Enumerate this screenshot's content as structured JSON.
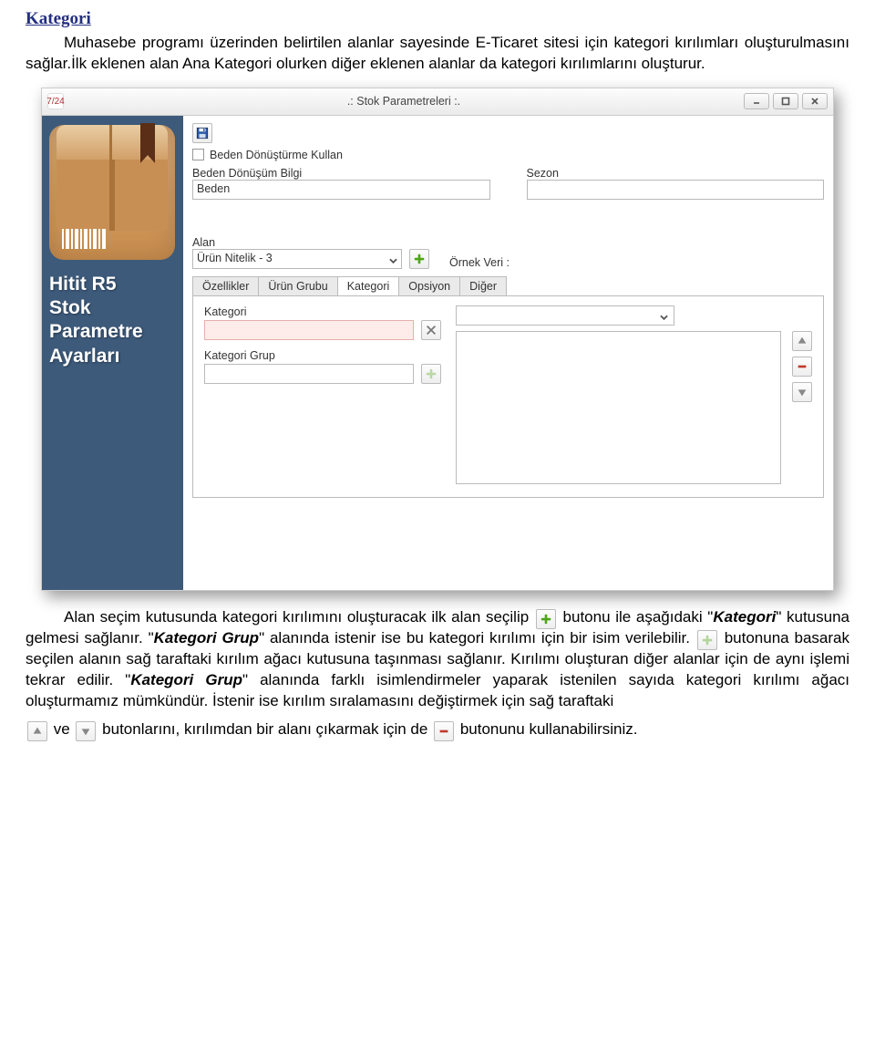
{
  "document": {
    "heading": "Kategori",
    "para1_prefix": "Muhasebe programı üzerinden belirtilen alanlar sayesinde E-Ticaret sitesi için kategori kırılımları oluşturulmasını sağlar.İlk eklenen alan Ana Kategori olurken diğer eklenen alanlar da kategori kırılımlarını oluşturur.",
    "para2_a": "Alan seçim kutusunda kategori kırılımını oluşturacak ilk alan seçilip",
    "para2_b": "butonu ile aşağıdaki \"",
    "para2_kategori": "Kategori",
    "para2_c": "\" kutusuna gelmesi sağlanır. \"",
    "para2_kgrup": "Kategori Grup",
    "para2_d": "\" alanında istenir ise bu kategori kırılımı için bir isim verilebilir.",
    "para2_e": "butonuna basarak seçilen alanın sağ taraftaki kırılım ağacı kutusuna taşınması sağlanır. Kırılımı oluşturan diğer alanlar için de aynı işlemi tekrar edilir. \"",
    "para2_f": "\" alanında farklı isimlendirmeler yaparak istenilen sayıda kategori kırılımı ağacı oluşturmamız mümkündür. İstenir ise kırılım sıralamasını değiştirmek için sağ taraftaki",
    "para3_a": "ve",
    "para3_b": "butonlarını, kırılımdan bir alanı çıkarmak  için de",
    "para3_c": "butonunu kullanabilirsiniz."
  },
  "window": {
    "title": ".: Stok Parametreleri :.",
    "sidebar_title_l1": "Hitit R5",
    "sidebar_title_l2": "Stok",
    "sidebar_title_l3": "Parametre",
    "sidebar_title_l4": "Ayarları",
    "chk_beden_donusturme": "Beden Dönüştürme Kullan",
    "lbl_beden_donusum_bilgi": "Beden Dönüşüm Bilgi",
    "val_beden": "Beden",
    "lbl_sezon": "Sezon",
    "lbl_alan": "Alan",
    "alan_value": "Ürün Nitelik - 3",
    "lbl_ornek": "Örnek Veri :",
    "tabs": {
      "ozellikler": "Özellikler",
      "urun_grubu": "Ürün Grubu",
      "kategori": "Kategori",
      "opsiyon": "Opsiyon",
      "diger": "Diğer"
    },
    "lbl_kategori": "Kategori",
    "lbl_kategori_grup": "Kategori Grup"
  }
}
